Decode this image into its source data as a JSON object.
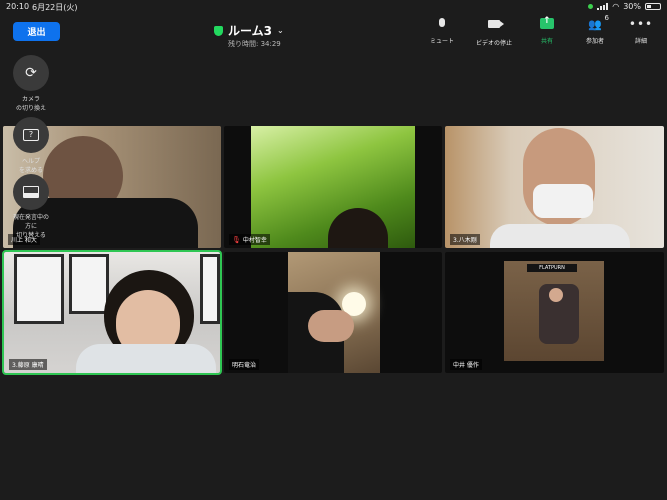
{
  "status_bar": {
    "time": "20:10",
    "date": "6月22日(火)",
    "battery": "30%",
    "battery_fraction": 0.3
  },
  "header": {
    "leave_label": "退出",
    "room_title": "ルーム3",
    "remaining": "残り時間: 34:29",
    "toolbar": {
      "mute_label": "ミュート",
      "video_label": "ビデオの停止",
      "share_label": "共有",
      "participants_label": "参加者",
      "participants_count": "6",
      "more_label": "詳細"
    }
  },
  "side_controls": {
    "camera_switch_label": "カメラ\nの切り換え",
    "help_label": "ヘルプ\nを求める",
    "speaker_view_label": "現在発言中の\n方に\n切り替える"
  },
  "participants": [
    {
      "name": "川上 和大",
      "muted": false,
      "active": false
    },
    {
      "name": "中村智幸",
      "muted": true,
      "active": false
    },
    {
      "name": "3.八木剛",
      "muted": false,
      "active": false
    },
    {
      "name": "3.藤原 康晴",
      "muted": false,
      "active": true
    },
    {
      "name": "明石竜治",
      "muted": false,
      "active": false
    },
    {
      "name": "中井 優作",
      "muted": false,
      "active": false
    }
  ],
  "poster_text": "FLATPURN"
}
